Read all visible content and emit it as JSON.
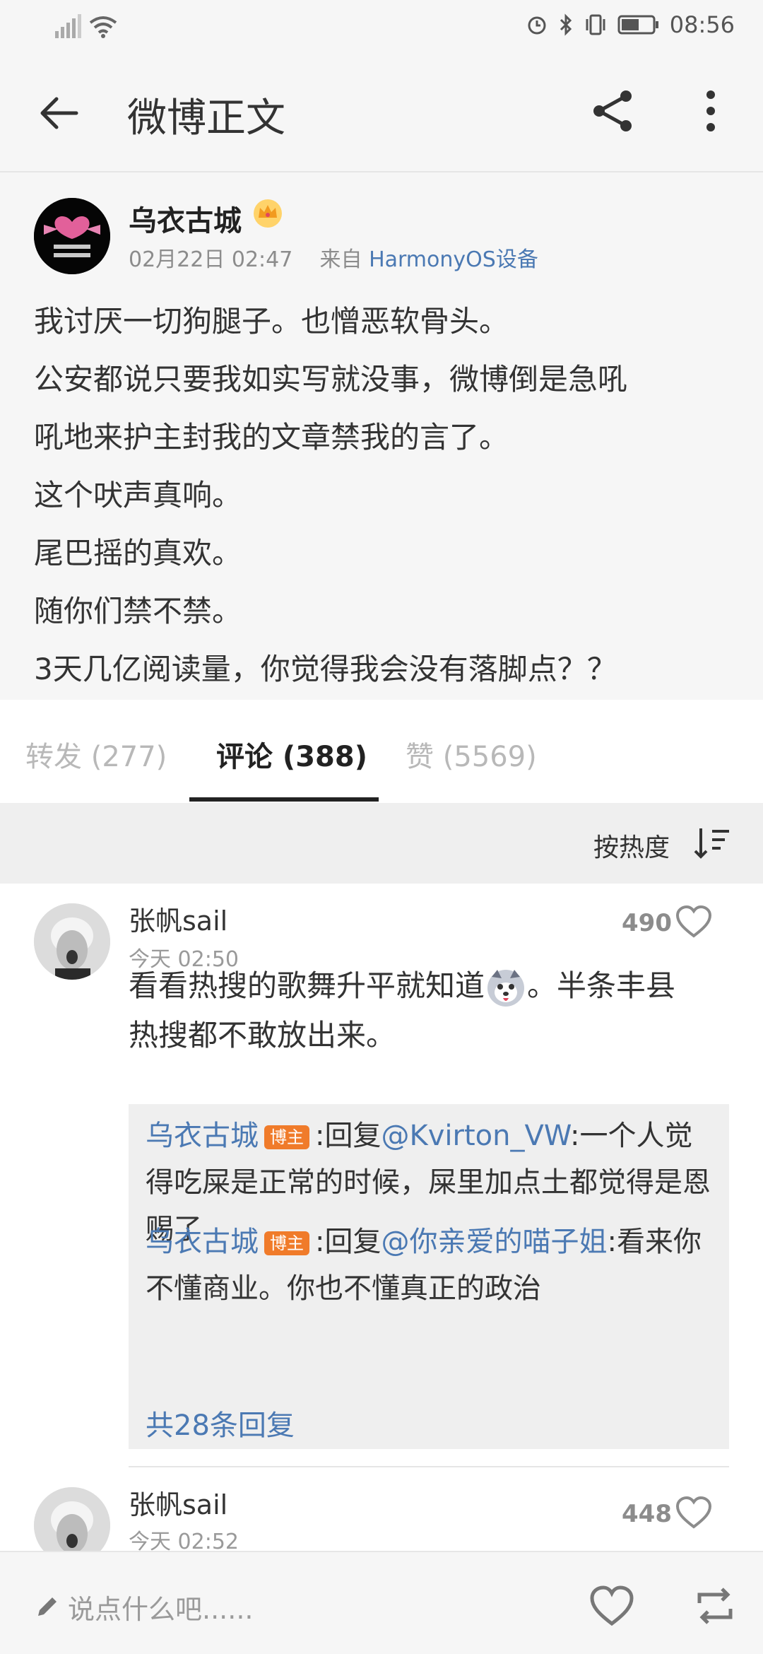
{
  "status_bar": {
    "time": "08:56"
  },
  "header": {
    "title": "微博正文"
  },
  "post": {
    "author": "乌衣古城",
    "date": "02月22日 02:47",
    "source_prefix": "来自",
    "source": "HarmonyOS设备",
    "lines": [
      "我讨厌一切狗腿子。也憎恶软骨头。",
      "公安都说只要我如实写就没事，微博倒是急吼",
      "吼地来护主封我的文章禁我的言了。",
      "这个吠声真响。",
      "尾巴摇的真欢。",
      "随你们禁不禁。",
      "3天几亿阅读量，你觉得我会没有落脚点？？"
    ]
  },
  "tabs": [
    {
      "label": "转发 (277)"
    },
    {
      "label": "评论 (388)"
    },
    {
      "label": "赞 (5569)"
    }
  ],
  "sort": {
    "label": "按热度"
  },
  "comments": [
    {
      "name": "张帆sail",
      "time": "今天 02:50",
      "likes": "490",
      "text_line1_a": "看看热搜的歌舞升平就知道",
      "text_line1_b": "。半条丰县",
      "text_line2": "热搜都不敢放出来。",
      "replies": [
        {
          "name": "乌衣古城",
          "badge": "博主",
          "prefix": ":回复",
          "mention": "@Kvirton_VW",
          "text": ":一个人觉得吃屎是正常的时候，屎里加点土都觉得是恩赐了"
        },
        {
          "name": "乌衣古城",
          "badge": "博主",
          "prefix": ":回复",
          "mention": "@你亲爱的喵子姐",
          "text": ":看来你不懂商业。你也不懂真正的政治"
        }
      ],
      "more_replies": "共28条回复"
    },
    {
      "name": "张帆sail",
      "time": "今天 02:52",
      "likes": "448"
    }
  ],
  "bottom_bar": {
    "placeholder": "说点什么吧......"
  },
  "colors": {
    "link": "#4b79b3",
    "badge": "#f07b2a",
    "background": "#f6f6f6"
  }
}
